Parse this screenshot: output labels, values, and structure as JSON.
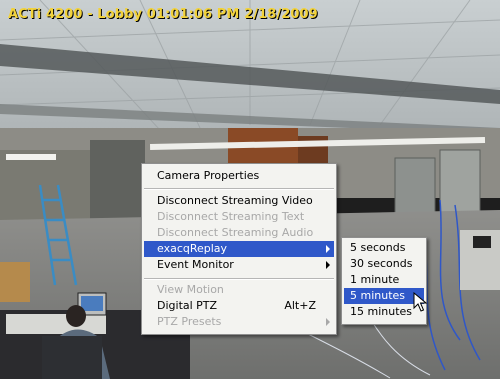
{
  "overlay": {
    "title": "ACTi 4200 - Lobby 01:01:06 PM 2/18/2009"
  },
  "context_menu": {
    "camera_properties": "Camera Properties",
    "disconnect_video": "Disconnect Streaming Video",
    "disconnect_text": "Disconnect Streaming Text",
    "disconnect_audio": "Disconnect Streaming Audio",
    "exacq_replay": "exacqReplay",
    "event_monitor": "Event Monitor",
    "view_motion": "View Motion",
    "digital_ptz": "Digital PTZ",
    "digital_ptz_shortcut": "Alt+Z",
    "ptz_presets": "PTZ Presets"
  },
  "submenu": {
    "items": [
      "5 seconds",
      "30 seconds",
      "1 minute",
      "5 minutes",
      "15 minutes"
    ],
    "highlighted_index": 3
  },
  "colors": {
    "overlay_text": "#f2d23a",
    "menu_highlight": "#2f58c9",
    "menu_background": "#f3f3f0",
    "disabled_text": "#a8a8a8"
  }
}
